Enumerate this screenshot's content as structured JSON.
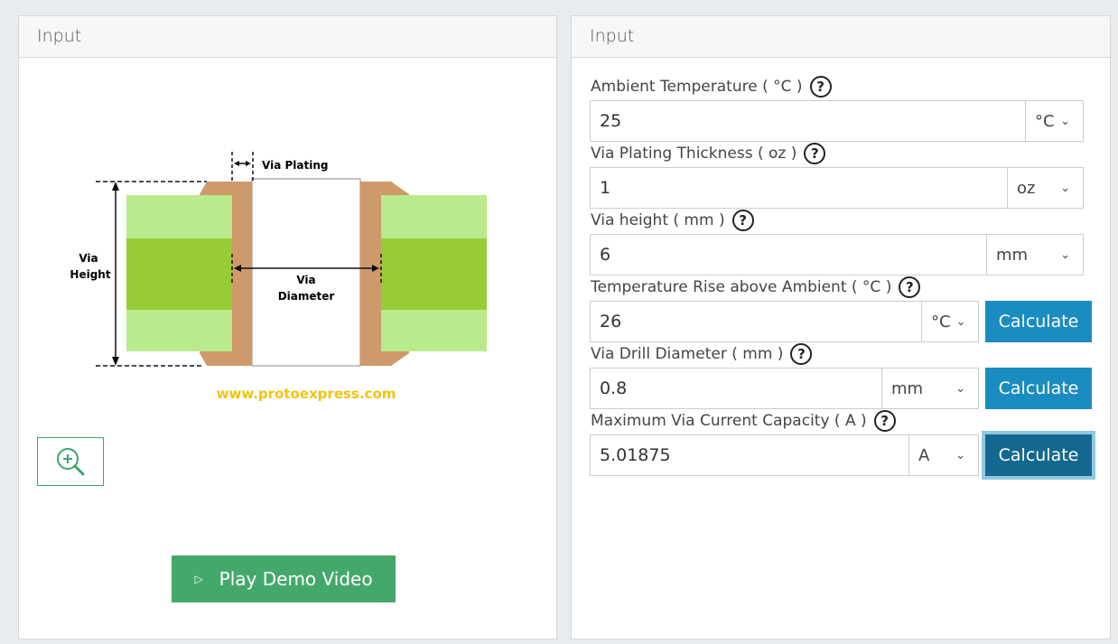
{
  "left_panel": {
    "title": "Input",
    "diagram": {
      "label_via_plating": "Via Plating",
      "label_via_height_1": "Via",
      "label_via_height_2": "Height",
      "label_via_diameter_1": "Via",
      "label_via_diameter_2": "Diameter",
      "watermark": "www.protoexpress.com"
    },
    "demo_button": "Play Demo Video",
    "zoom_icon": "zoom-in-icon"
  },
  "right_panel": {
    "title": "Input",
    "fields": [
      {
        "label": "Ambient Temperature ( °C )",
        "value": "25",
        "unit": "°C"
      },
      {
        "label": "Via Plating Thickness ( oz )",
        "value": "1",
        "unit": "oz"
      },
      {
        "label": "Via height ( mm )",
        "value": "6",
        "unit": "mm"
      },
      {
        "label": "Temperature Rise above Ambient ( °C )",
        "value": "26",
        "unit": "°C",
        "button": "Calculate"
      },
      {
        "label": "Via Drill Diameter ( mm )",
        "value": "0.8",
        "unit": "mm",
        "button": "Calculate"
      },
      {
        "label": "Maximum Via Current Capacity ( A )",
        "value": "5.01875",
        "unit": "A",
        "button": "Calculate"
      }
    ],
    "help_symbol": "?",
    "chevron": "⌄"
  },
  "colors": {
    "accent_blue": "#1b8cbf",
    "green_button": "#45a86b",
    "copper": "#cf9a6a",
    "light_green": "#b9eb8e",
    "dark_green": "#97cc36",
    "watermark": "#f2c40f"
  }
}
